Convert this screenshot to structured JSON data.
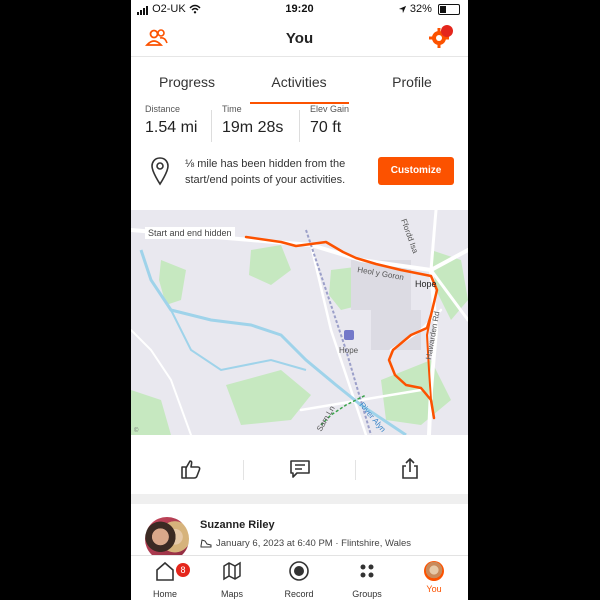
{
  "status_bar": {
    "carrier": "O2-UK",
    "time": "19:20",
    "battery": "32%"
  },
  "header": {
    "title": "You"
  },
  "tabs": [
    {
      "label": "Progress"
    },
    {
      "label": "Activities"
    },
    {
      "label": "Profile"
    }
  ],
  "active_tab": "Activities",
  "stats": [
    {
      "label": "Distance",
      "value": "1.54 mi"
    },
    {
      "label": "Time",
      "value": "19m 28s"
    },
    {
      "label": "Elev Gain",
      "value": "70 ft"
    }
  ],
  "privacy": {
    "text": "⅛ mile has been hidden from the start/end points of your activities.",
    "button": "Customize"
  },
  "map": {
    "overlay_label": "Start and end hidden",
    "place_labels": [
      "Hope",
      "Hope",
      "Hope",
      "River Alyn",
      "Sarn Ln",
      "Heol y Goron",
      "Hawarden Rd",
      "Ffordd Isa"
    ],
    "route_color": "#fc5200"
  },
  "actions": [
    "like-icon",
    "comment-icon",
    "share-icon"
  ],
  "athlete": {
    "name": "Suzanne Riley",
    "meta": "January 6, 2023 at 6:40 PM · Flintshire, Wales"
  },
  "nav": [
    {
      "label": "Home",
      "badge": "8"
    },
    {
      "label": "Maps"
    },
    {
      "label": "Record"
    },
    {
      "label": "Groups"
    },
    {
      "label": "You"
    }
  ],
  "colors": {
    "accent": "#fc5200",
    "badge": "#e4261c"
  }
}
